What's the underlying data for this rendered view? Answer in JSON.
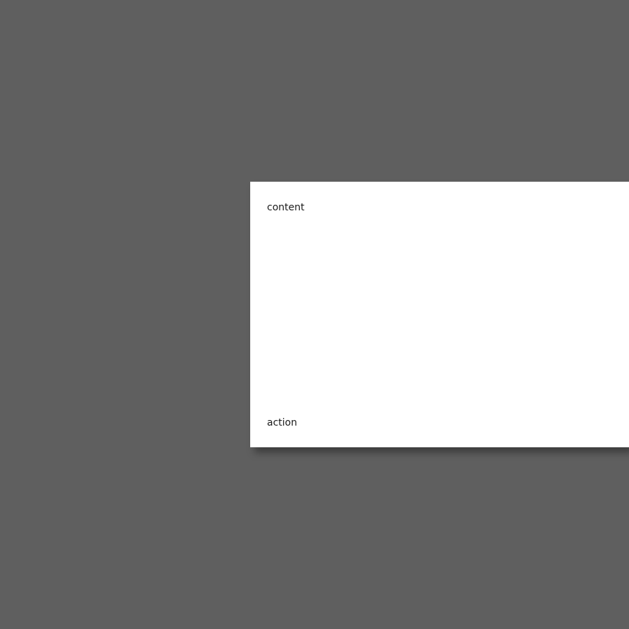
{
  "dialog": {
    "content_text": "content",
    "action_text": "action"
  }
}
